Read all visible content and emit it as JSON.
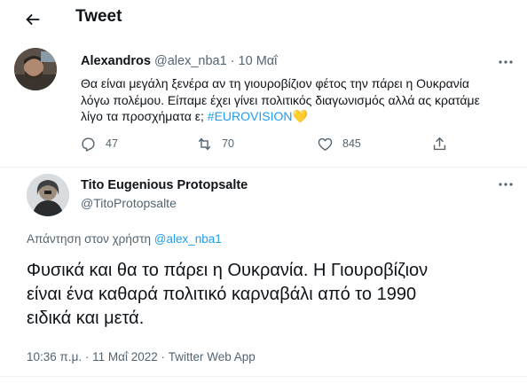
{
  "header": {
    "title": "Tweet"
  },
  "quoted_tweet": {
    "author_name": "Alexandros",
    "handle": "@alex_nba1",
    "separator": " · ",
    "date": "10 Μαΐ",
    "text_line1": "Θα είναι μεγάλη ξενέρα αν τη γιουροβίζιον φέτος την πάρει η Ουκρανία",
    "text_line2": "λόγω πολέμου. Είπαμε έχει γίνει πολιτικός διαγωνισμός αλλά ας κρατάμε",
    "text_line3": "λίγο τα προσχήματα ε;",
    "hashtag": "#EUROVISION",
    "emoji": "💛",
    "replies": "47",
    "retweets": "70",
    "likes": "845"
  },
  "main_tweet": {
    "author_name": "Tito Eugenious Protopsalte",
    "handle": "@TitoProtopsalte",
    "reply_prefix": "Απάντηση στον χρήστη ",
    "reply_handle": "@alex_nba1",
    "text_line1": "Φυσικά και θα το πάρει η Ουκρανία. Η Γιουροβίζιον",
    "text_line2": "είναι ένα καθαρά πολιτικό καρναβάλι από το 1990",
    "text_line3": "ειδικά και μετά.",
    "time": "10:36 π.μ.",
    "dot": " · ",
    "date": "11 Μαΐ 2022",
    "source": "Twitter Web App"
  },
  "colors": {
    "accent": "#1d9bf0",
    "muted": "#536471",
    "text": "#0f1419",
    "heart": "#f5c518"
  }
}
